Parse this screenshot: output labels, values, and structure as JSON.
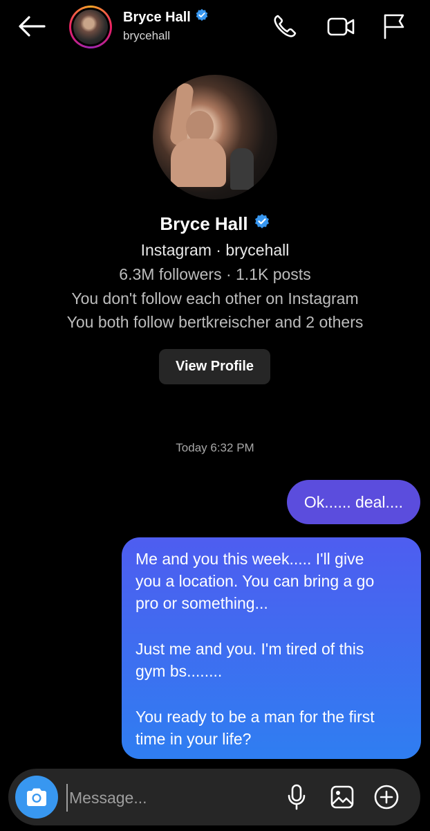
{
  "header": {
    "name": "Bryce Hall",
    "username": "brycehall",
    "icons": [
      "back-arrow-icon",
      "phone-icon",
      "video-camera-icon",
      "flag-icon"
    ]
  },
  "profile": {
    "name": "Bryce Hall",
    "line1": "Instagram · brycehall",
    "line2": "6.3M followers · 1.1K posts",
    "line3": "You don't follow each other on Instagram",
    "line4": "You both follow bertkreischer and 2 others",
    "view_profile_label": "View Profile"
  },
  "thread": {
    "timestamp": "Today 6:32 PM",
    "messages": [
      {
        "text": "Ok...... deal...."
      },
      {
        "para1_l1": "Me and you this week..... I'll give",
        "para1_l2": "you a location. You can bring a go",
        "para1_l3": "pro or something...",
        "para2_l1": "Just me and you. I'm tired of this",
        "para2_l2": "gym bs........",
        "para3_l1": "You ready to be a man for the first",
        "para3_l2": "time in your life?"
      }
    ]
  },
  "composer": {
    "placeholder": "Message...",
    "icons": [
      "camera-icon",
      "microphone-icon",
      "gallery-icon",
      "add-icon"
    ]
  },
  "colors": {
    "background": "#000000",
    "verified": "#3897f0",
    "bubble_purple": "#5b4ddd",
    "bubble_gradient_top": "#4e5df0",
    "bubble_gradient_bottom": "#2f7ef1",
    "camera_button": "#3897f0",
    "composer_bg": "#262626"
  }
}
